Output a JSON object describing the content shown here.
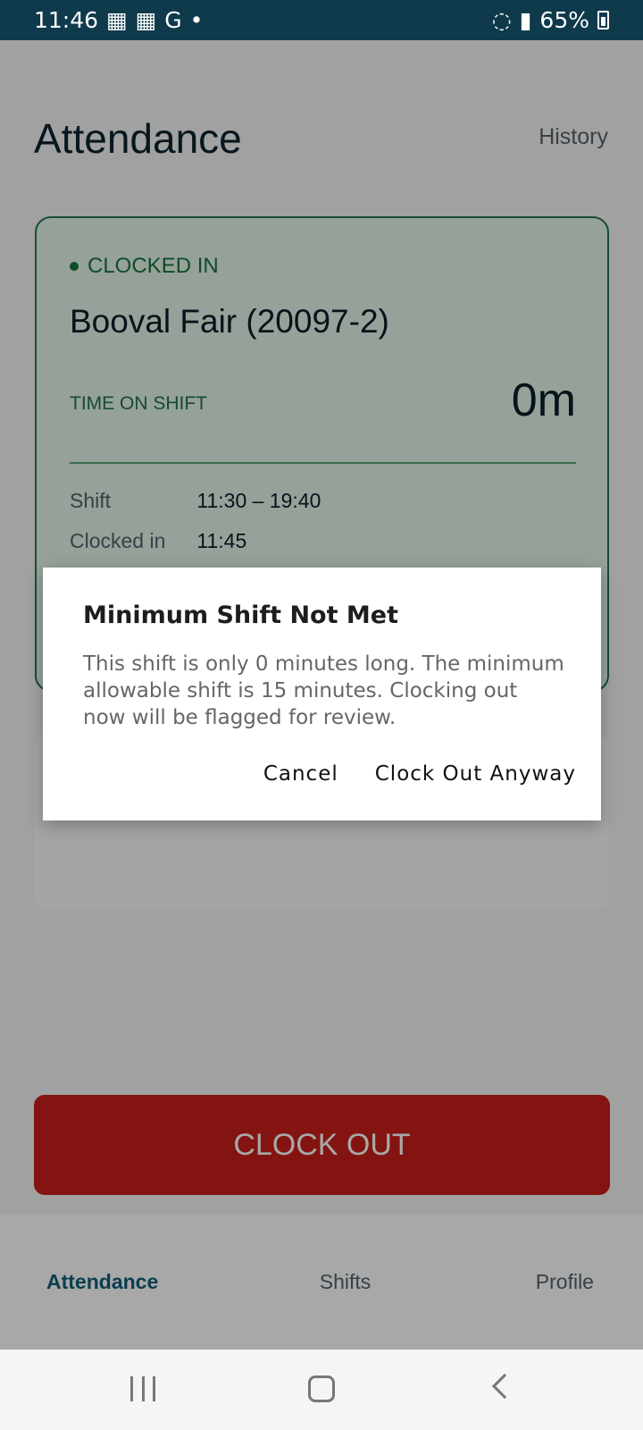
{
  "status_bar": {
    "time": "11:46",
    "battery_percent": "65%",
    "icons": [
      "calendar-icon",
      "calendar-icon",
      "google-icon",
      "notification-dot-icon",
      "wifi-icon",
      "signal-icon",
      "battery-icon"
    ]
  },
  "header": {
    "title": "Attendance",
    "history": "History"
  },
  "shift_card": {
    "status": "CLOCKED IN",
    "location": "Booval Fair (20097-2)",
    "time_on_shift_label": "TIME ON SHIFT",
    "time_on_shift": "0m",
    "details": [
      {
        "label": "Shift",
        "value": "11:30 – 19:40"
      },
      {
        "label": "Clocked in",
        "value": "11:45"
      }
    ]
  },
  "actions": {
    "clock_out": "CLOCK OUT"
  },
  "bottom_nav": {
    "items": [
      {
        "label": "Attendance",
        "active": true
      },
      {
        "label": "Shifts",
        "active": false
      },
      {
        "label": "Profile",
        "active": false
      }
    ]
  },
  "dialog": {
    "title": "Minimum Shift Not Met",
    "message": "This shift is only 0 minutes long. The minimum allowable shift is 15 minutes. Clocking out now will be flagged for review.",
    "cancel": "Cancel",
    "confirm": "Clock Out Anyway"
  },
  "colors": {
    "status_bar": "#0e3a4c",
    "accent_green": "#17743f",
    "card_background": "#e3f4e8",
    "danger": "#c91f1a",
    "active_nav": "#0e5f78"
  }
}
